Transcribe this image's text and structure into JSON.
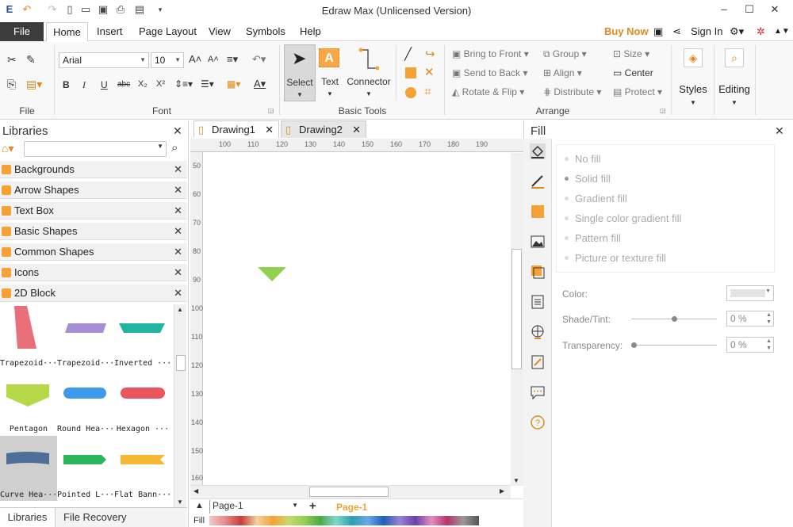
{
  "window": {
    "title": "Edraw Max (Unlicensed Version)"
  },
  "menu": {
    "tabs": [
      "File",
      "Home",
      "Insert",
      "Page Layout",
      "View",
      "Symbols",
      "Help"
    ],
    "buy_now": "Buy Now",
    "sign_in": "Sign In"
  },
  "ribbon": {
    "file_group": "File",
    "font_group": "Font",
    "font_name": "Arial",
    "font_size": "10",
    "basic_tools_group": "Basic Tools",
    "select_label": "Select",
    "text_label": "Text",
    "connector_label": "Connector",
    "arrange_group": "Arrange",
    "bring_to_front": "Bring to Front",
    "send_to_back": "Send to Back",
    "rotate_flip": "Rotate & Flip",
    "group": "Group",
    "align": "Align",
    "distribute": "Distribute",
    "size": "Size",
    "center": "Center",
    "protect": "Protect",
    "styles_label": "Styles",
    "editing_label": "Editing"
  },
  "libraries": {
    "title": "Libraries",
    "items": [
      "Backgrounds",
      "Arrow Shapes",
      "Text Box",
      "Basic Shapes",
      "Common Shapes",
      "Icons",
      "2D Block"
    ],
    "shapes": [
      "Trapezoid···",
      "Trapezoid···",
      "Inverted ···",
      "Pentagon",
      "Round Hea···",
      "Hexagon ···",
      "Curve Hea···",
      "Pointed L···",
      "Flat Bann···"
    ],
    "bottom_tabs": [
      "Libraries",
      "File Recovery"
    ]
  },
  "documents": {
    "tabs": [
      "Drawing1",
      "Drawing2"
    ]
  },
  "ruler": {
    "top": [
      "100",
      "110",
      "120",
      "130",
      "140",
      "150",
      "160",
      "170",
      "180",
      "190"
    ],
    "left": [
      "50",
      "60",
      "70",
      "80",
      "90",
      "100",
      "110",
      "120",
      "130",
      "140",
      "150",
      "160"
    ]
  },
  "pages": {
    "current": "Page-1",
    "tab": "Page-1",
    "fill_label": "Fill"
  },
  "fill": {
    "title": "Fill",
    "options": [
      "No fill",
      "Solid fill",
      "Gradient fill",
      "Single color gradient fill",
      "Pattern fill",
      "Picture or texture fill"
    ],
    "color_label": "Color:",
    "shade_label": "Shade/Tint:",
    "shade_value": "0 %",
    "transparency_label": "Transparency:",
    "transparency_value": "0 %"
  },
  "colors": {
    "shape_fill": "#92d050",
    "accent": "#f4a236"
  }
}
